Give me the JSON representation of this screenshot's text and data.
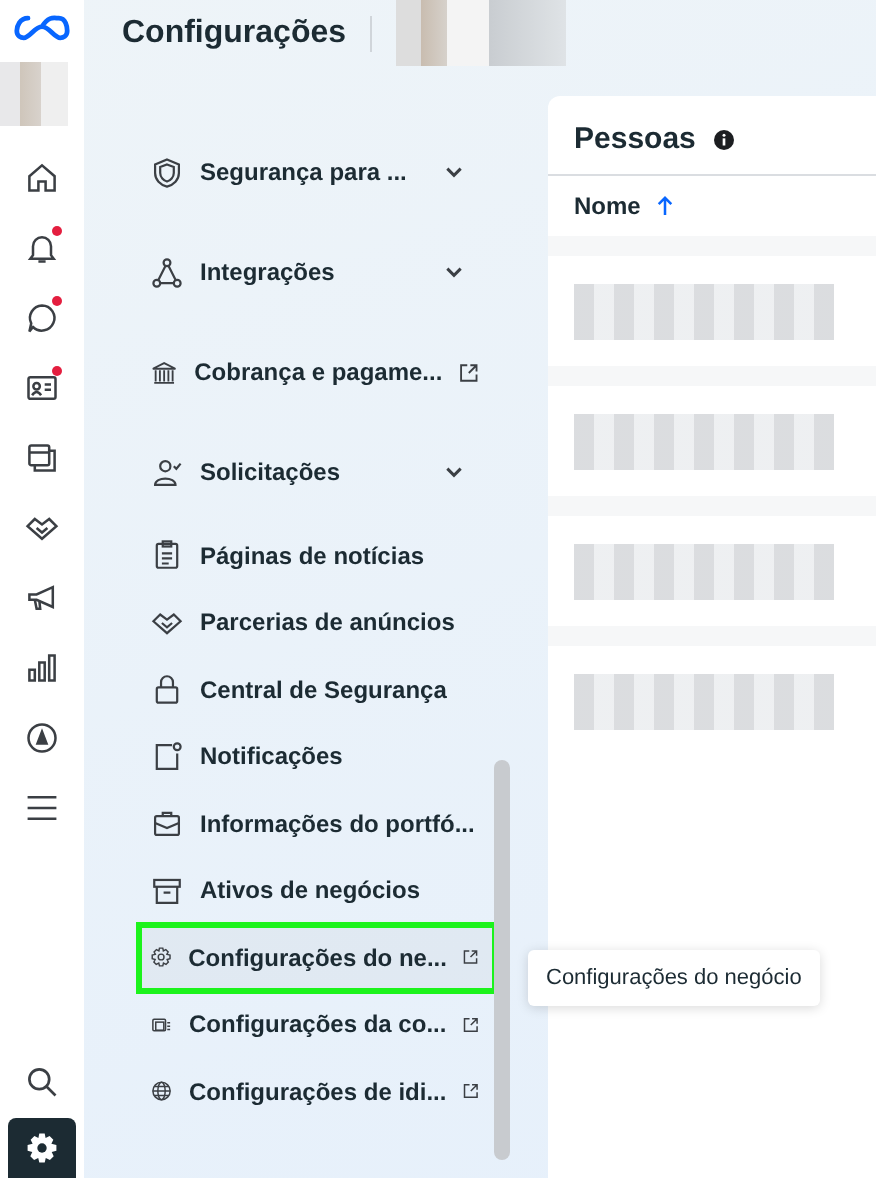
{
  "header": {
    "title": "Configurações"
  },
  "rail": {
    "items": [
      {
        "badge": false
      },
      {
        "badge": true
      },
      {
        "badge": true
      },
      {
        "badge": true
      },
      {
        "badge": false
      },
      {
        "badge": false
      },
      {
        "badge": false
      },
      {
        "badge": false
      },
      {
        "badge": false
      },
      {
        "badge": false
      }
    ],
    "bottom": [
      {
        "selected": false
      },
      {
        "selected": true
      }
    ]
  },
  "menu": {
    "sections": [
      {
        "kind": "expander",
        "label": "Segurança para ..."
      },
      {
        "kind": "expander",
        "label": "Integrações"
      },
      {
        "kind": "external",
        "label": "Cobrança e pagame..."
      },
      {
        "kind": "expander",
        "label": "Solicitações"
      }
    ],
    "pages": [
      {
        "kind": "plain",
        "label": "Páginas de notícias",
        "highlighted": false
      },
      {
        "kind": "plain",
        "label": "Parcerias de anúncios",
        "highlighted": false
      },
      {
        "kind": "plain",
        "label": "Central de Segurança",
        "highlighted": false
      },
      {
        "kind": "plain",
        "label": "Notificações",
        "highlighted": false
      },
      {
        "kind": "plain",
        "label": "Informações do portfó...",
        "highlighted": false
      },
      {
        "kind": "plain",
        "label": "Ativos de negócios",
        "highlighted": false
      },
      {
        "kind": "external",
        "label": "Configurações do ne...",
        "highlighted": true
      },
      {
        "kind": "external",
        "label": "Configurações da co...",
        "highlighted": false
      },
      {
        "kind": "external",
        "label": "Configurações de idi...",
        "highlighted": false
      }
    ]
  },
  "tooltip": {
    "text": "Configurações do negócio"
  },
  "panel": {
    "title": "Pessoas",
    "column": "Nome",
    "sort_ascending": true
  }
}
